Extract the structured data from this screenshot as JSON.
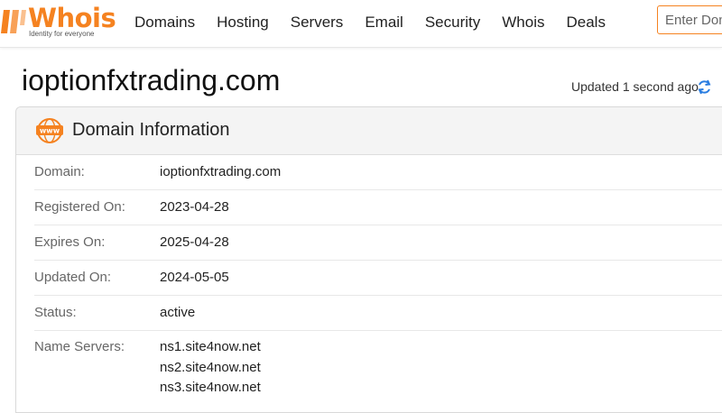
{
  "brand": {
    "name": "Whois",
    "tagline": "Identity for everyone",
    "accent": "#f58220"
  },
  "nav": {
    "items": [
      "Domains",
      "Hosting",
      "Servers",
      "Email",
      "Security",
      "Whois",
      "Deals"
    ]
  },
  "search": {
    "placeholder": "Enter Domain"
  },
  "page": {
    "domain": "ioptionfxtrading.com",
    "updated_text": "Updated 1 second ago"
  },
  "panel": {
    "title": "Domain Information",
    "icon": "www-icon",
    "rows": [
      {
        "label": "Domain:",
        "value": "ioptionfxtrading.com"
      },
      {
        "label": "Registered On:",
        "value": "2023-04-28"
      },
      {
        "label": "Expires On:",
        "value": "2025-04-28"
      },
      {
        "label": "Updated On:",
        "value": "2024-05-05"
      },
      {
        "label": "Status:",
        "value": "active"
      },
      {
        "label": "Name Servers:",
        "values": [
          "ns1.site4now.net",
          "ns2.site4now.net",
          "ns3.site4now.net"
        ]
      }
    ]
  }
}
